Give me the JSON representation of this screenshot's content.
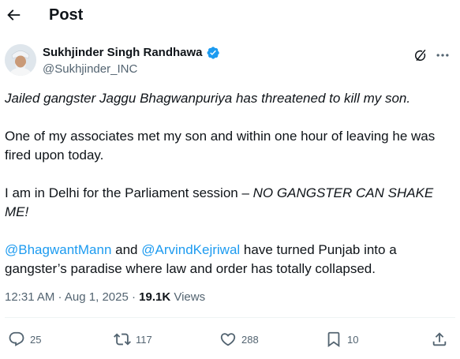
{
  "header": {
    "title": "Post"
  },
  "author": {
    "name": "Sukhjinder Singh Randhawa",
    "handle": "@Sukhjinder_INC"
  },
  "post": {
    "p1": "Jailed gangster Jaggu Bhagwanpuriya has threatened to kill my son.",
    "p2": "One of my associates met my son and within one hour of leaving he was fired upon today.",
    "p3_plain": "I am in Delhi for the Parliament session – ",
    "p3_italic": "NO GANGSTER CAN SHAKE ME!",
    "p4_mention1": "@BhagwantMann",
    "p4_and": " and ",
    "p4_mention2": "@ArvindKejriwal",
    "p4_rest": " have turned Punjab into a gangster’s paradise where law and order has totally collapsed."
  },
  "meta": {
    "time": "12:31 AM",
    "sep": " · ",
    "date": "Aug 1, 2025",
    "views_count": "19.1K",
    "views_label": " Views"
  },
  "actions": {
    "replies": "25",
    "reposts": "117",
    "likes": "288",
    "bookmarks": "10"
  },
  "icons": {
    "back": "back-arrow-icon",
    "verified": "verified-badge-icon",
    "grok": "grok-icon",
    "more": "more-icon",
    "reply": "reply-icon",
    "repost": "repost-icon",
    "like": "like-icon",
    "bookmark": "bookmark-icon",
    "share": "share-icon"
  },
  "colors": {
    "accent": "#1d9bf0",
    "text": "#0f1419",
    "secondary": "#536471"
  }
}
